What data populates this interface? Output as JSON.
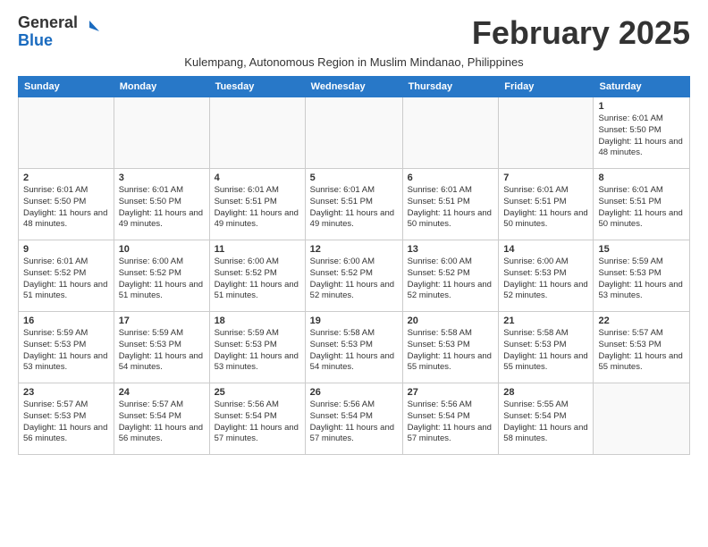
{
  "header": {
    "logo_general": "General",
    "logo_blue": "Blue",
    "month_title": "February 2025",
    "subtitle": "Kulempang, Autonomous Region in Muslim Mindanao, Philippines"
  },
  "days_of_week": [
    "Sunday",
    "Monday",
    "Tuesday",
    "Wednesday",
    "Thursday",
    "Friday",
    "Saturday"
  ],
  "weeks": [
    [
      {
        "day": "",
        "info": "",
        "empty": true
      },
      {
        "day": "",
        "info": "",
        "empty": true
      },
      {
        "day": "",
        "info": "",
        "empty": true
      },
      {
        "day": "",
        "info": "",
        "empty": true
      },
      {
        "day": "",
        "info": "",
        "empty": true
      },
      {
        "day": "",
        "info": "",
        "empty": true
      },
      {
        "day": "1",
        "info": "Sunrise: 6:01 AM\nSunset: 5:50 PM\nDaylight: 11 hours and 48 minutes."
      }
    ],
    [
      {
        "day": "2",
        "info": "Sunrise: 6:01 AM\nSunset: 5:50 PM\nDaylight: 11 hours and 48 minutes."
      },
      {
        "day": "3",
        "info": "Sunrise: 6:01 AM\nSunset: 5:50 PM\nDaylight: 11 hours and 49 minutes."
      },
      {
        "day": "4",
        "info": "Sunrise: 6:01 AM\nSunset: 5:51 PM\nDaylight: 11 hours and 49 minutes."
      },
      {
        "day": "5",
        "info": "Sunrise: 6:01 AM\nSunset: 5:51 PM\nDaylight: 11 hours and 49 minutes."
      },
      {
        "day": "6",
        "info": "Sunrise: 6:01 AM\nSunset: 5:51 PM\nDaylight: 11 hours and 50 minutes."
      },
      {
        "day": "7",
        "info": "Sunrise: 6:01 AM\nSunset: 5:51 PM\nDaylight: 11 hours and 50 minutes."
      },
      {
        "day": "8",
        "info": "Sunrise: 6:01 AM\nSunset: 5:51 PM\nDaylight: 11 hours and 50 minutes."
      }
    ],
    [
      {
        "day": "9",
        "info": "Sunrise: 6:01 AM\nSunset: 5:52 PM\nDaylight: 11 hours and 51 minutes."
      },
      {
        "day": "10",
        "info": "Sunrise: 6:00 AM\nSunset: 5:52 PM\nDaylight: 11 hours and 51 minutes."
      },
      {
        "day": "11",
        "info": "Sunrise: 6:00 AM\nSunset: 5:52 PM\nDaylight: 11 hours and 51 minutes."
      },
      {
        "day": "12",
        "info": "Sunrise: 6:00 AM\nSunset: 5:52 PM\nDaylight: 11 hours and 52 minutes."
      },
      {
        "day": "13",
        "info": "Sunrise: 6:00 AM\nSunset: 5:52 PM\nDaylight: 11 hours and 52 minutes."
      },
      {
        "day": "14",
        "info": "Sunrise: 6:00 AM\nSunset: 5:53 PM\nDaylight: 11 hours and 52 minutes."
      },
      {
        "day": "15",
        "info": "Sunrise: 5:59 AM\nSunset: 5:53 PM\nDaylight: 11 hours and 53 minutes."
      }
    ],
    [
      {
        "day": "16",
        "info": "Sunrise: 5:59 AM\nSunset: 5:53 PM\nDaylight: 11 hours and 53 minutes."
      },
      {
        "day": "17",
        "info": "Sunrise: 5:59 AM\nSunset: 5:53 PM\nDaylight: 11 hours and 54 minutes."
      },
      {
        "day": "18",
        "info": "Sunrise: 5:59 AM\nSunset: 5:53 PM\nDaylight: 11 hours and 53 minutes."
      },
      {
        "day": "19",
        "info": "Sunrise: 5:58 AM\nSunset: 5:53 PM\nDaylight: 11 hours and 54 minutes."
      },
      {
        "day": "20",
        "info": "Sunrise: 5:58 AM\nSunset: 5:53 PM\nDaylight: 11 hours and 55 minutes."
      },
      {
        "day": "21",
        "info": "Sunrise: 5:58 AM\nSunset: 5:53 PM\nDaylight: 11 hours and 55 minutes."
      },
      {
        "day": "22",
        "info": "Sunrise: 5:57 AM\nSunset: 5:53 PM\nDaylight: 11 hours and 55 minutes."
      }
    ],
    [
      {
        "day": "23",
        "info": "Sunrise: 5:57 AM\nSunset: 5:53 PM\nDaylight: 11 hours and 56 minutes."
      },
      {
        "day": "24",
        "info": "Sunrise: 5:57 AM\nSunset: 5:54 PM\nDaylight: 11 hours and 56 minutes."
      },
      {
        "day": "25",
        "info": "Sunrise: 5:56 AM\nSunset: 5:54 PM\nDaylight: 11 hours and 57 minutes."
      },
      {
        "day": "26",
        "info": "Sunrise: 5:56 AM\nSunset: 5:54 PM\nDaylight: 11 hours and 57 minutes."
      },
      {
        "day": "27",
        "info": "Sunrise: 5:56 AM\nSunset: 5:54 PM\nDaylight: 11 hours and 57 minutes."
      },
      {
        "day": "28",
        "info": "Sunrise: 5:55 AM\nSunset: 5:54 PM\nDaylight: 11 hours and 58 minutes."
      },
      {
        "day": "",
        "info": "",
        "empty": true
      }
    ]
  ]
}
